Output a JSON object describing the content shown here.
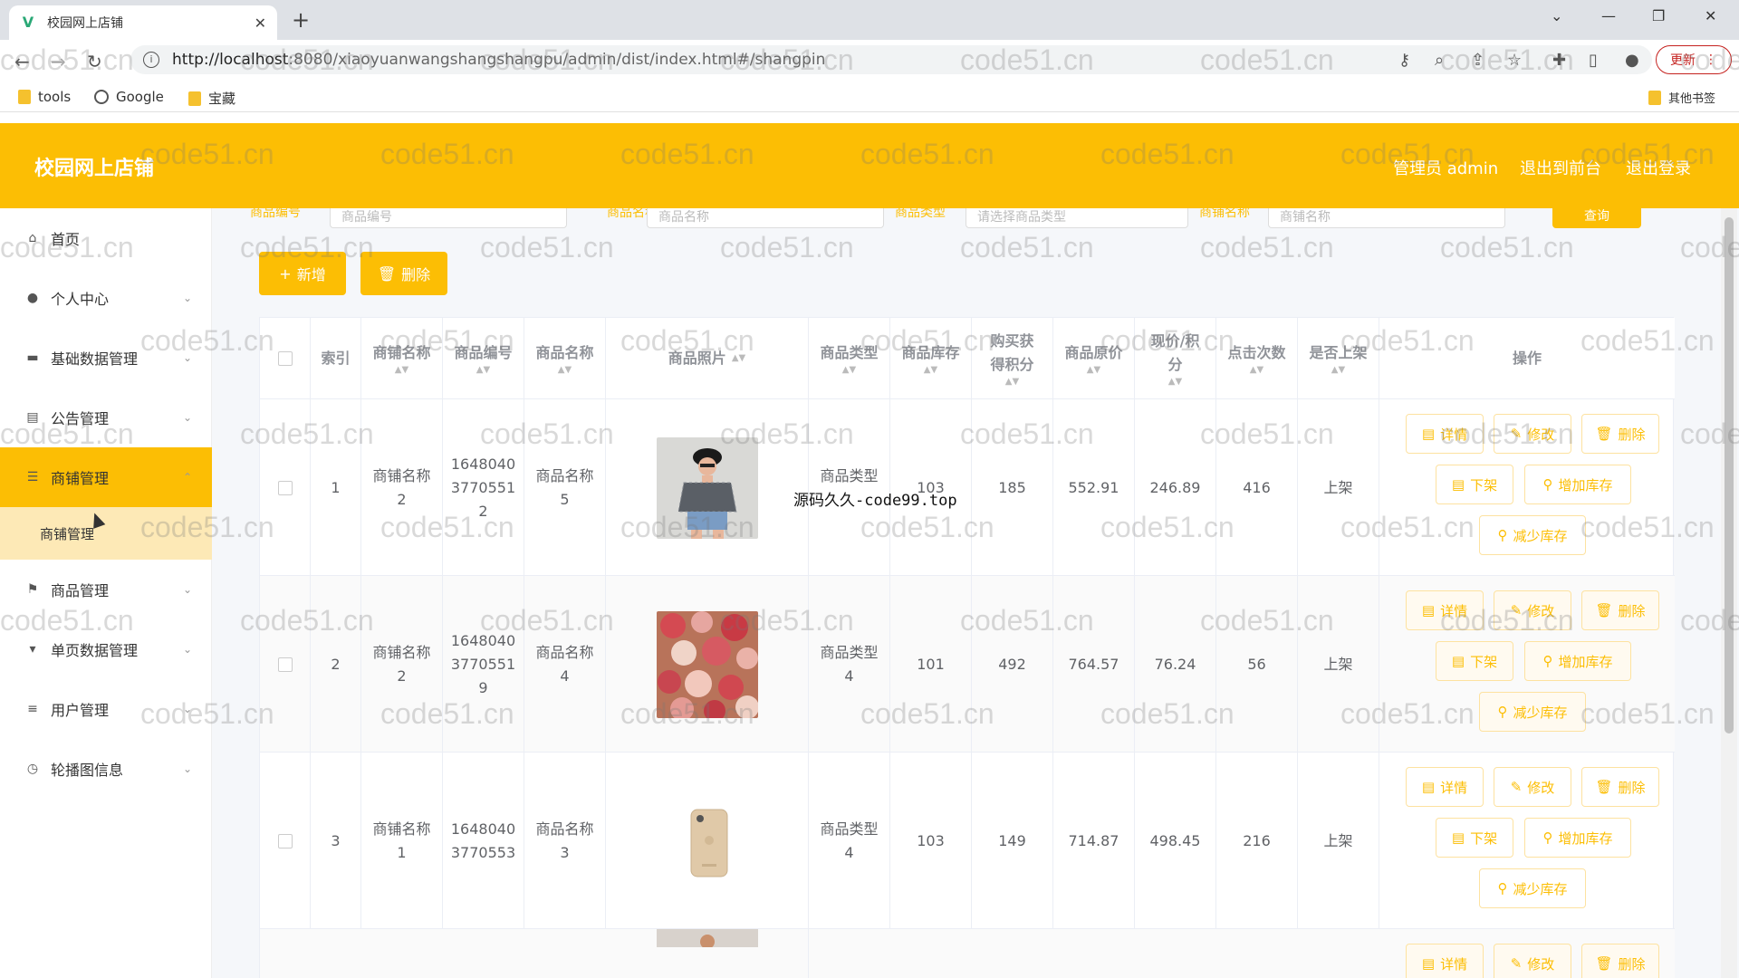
{
  "browser": {
    "tab_title": "校园网上店铺",
    "tab_icon": "V",
    "url_host": "http://localhost",
    "url_path": ":8080/xiaoyuanwangshangshangpu/admin/dist/index.html#/shangpin",
    "update_label": "更新",
    "bookmarks": [
      "tools",
      "Google",
      "宝藏"
    ],
    "other_bookmarks": "其他书签"
  },
  "app": {
    "title": "校园网上店铺",
    "admin_label": "管理员 admin",
    "back_front": "退出到前台",
    "logout": "退出登录",
    "accent_color": "#fcbe04"
  },
  "sidebar": {
    "items": [
      {
        "label": "首页",
        "icon": "home-icon"
      },
      {
        "label": "个人中心",
        "icon": "user-icon"
      },
      {
        "label": "基础数据管理",
        "icon": "briefcase-icon"
      },
      {
        "label": "公告管理",
        "icon": "clipboard-icon"
      },
      {
        "label": "商铺管理",
        "icon": "list-icon"
      },
      {
        "label": "商品管理",
        "icon": "flag-icon"
      },
      {
        "label": "单页数据管理",
        "icon": "sign-icon"
      },
      {
        "label": "用户管理",
        "icon": "menu-icon"
      },
      {
        "label": "轮播图信息",
        "icon": "clock-icon"
      }
    ],
    "sub_item": "商铺管理"
  },
  "search": {
    "labels": [
      "商品编号",
      "商品名称",
      "商品类型",
      "商铺名称"
    ],
    "placeholders": [
      "商品编号",
      "商品名称",
      "请选择商品类型",
      "商铺名称"
    ],
    "button": "查询"
  },
  "actions": {
    "add": "新增",
    "delete": "删除"
  },
  "table": {
    "headers": [
      "索引",
      "商铺名称",
      "商品编号",
      "商品名称",
      "商品照片",
      "商品类型",
      "商品库存",
      "购买获得积分",
      "商品原价",
      "现价/积分",
      "点击次数",
      "是否上架",
      "操作"
    ],
    "op_labels": {
      "detail": "详情",
      "edit": "修改",
      "delete": "删除",
      "off": "下架",
      "add_stock": "增加库存",
      "reduce_stock": "减少库存"
    },
    "rows": [
      {
        "index": "1",
        "shop": "商铺名称2",
        "code": "16480403770551 2",
        "name": "商品名称5",
        "type": "商品类型",
        "stock": "103",
        "points": "185",
        "orig": "552.91",
        "price": "246.89",
        "clicks": "416",
        "status": "上架",
        "photo": "photo-girl"
      },
      {
        "index": "2",
        "shop": "商铺名称2",
        "code": "16480403770551 9",
        "name": "商品名称4",
        "type": "商品类型4",
        "stock": "101",
        "points": "492",
        "orig": "764.57",
        "price": "76.24",
        "clicks": "56",
        "status": "上架",
        "photo": "photo-roses"
      },
      {
        "index": "3",
        "shop": "商铺名称1",
        "code": "16480403770553",
        "name": "商品名称3",
        "type": "商品类型4",
        "stock": "103",
        "points": "149",
        "orig": "714.87",
        "price": "498.45",
        "clicks": "216",
        "status": "上架",
        "photo": "photo-phone"
      }
    ]
  },
  "overlay_text": "源码久久-code99.top",
  "watermark": "code51.cn"
}
